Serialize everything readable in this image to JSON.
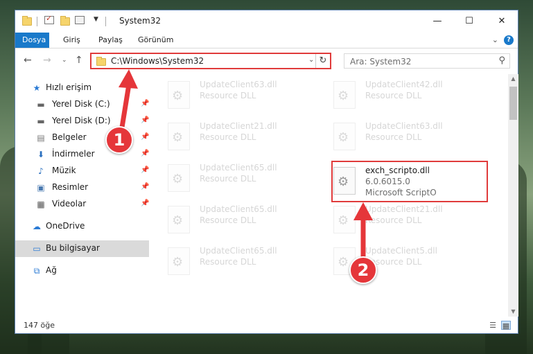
{
  "window": {
    "title": "System32",
    "controls": {
      "minimize": "—",
      "maximize": "☐",
      "close": "✕"
    }
  },
  "ribbon": {
    "tabs": [
      "Dosya",
      "Giriş",
      "Paylaş",
      "Görünüm"
    ],
    "help": "?"
  },
  "navigation": {
    "address": "C:\\Windows\\System32",
    "search_placeholder": "Ara: System32"
  },
  "sidebar": {
    "items": [
      {
        "label": "Hızlı erişim",
        "icon": "star-icon",
        "pinned": false
      },
      {
        "label": "Yerel Disk (C:)",
        "icon": "drive-icon",
        "pinned": true
      },
      {
        "label": "Yerel Disk (D:)",
        "icon": "drive-icon",
        "pinned": true
      },
      {
        "label": "Belgeler",
        "icon": "documents-icon",
        "pinned": true
      },
      {
        "label": "İndirmeler",
        "icon": "download-icon",
        "pinned": true
      },
      {
        "label": "Müzik",
        "icon": "music-icon",
        "pinned": true
      },
      {
        "label": "Resimler",
        "icon": "pictures-icon",
        "pinned": true
      },
      {
        "label": "Videolar",
        "icon": "videos-icon",
        "pinned": true
      },
      {
        "label": "OneDrive",
        "icon": "cloud-icon",
        "pinned": false
      },
      {
        "label": "Bu bilgisayar",
        "icon": "computer-icon",
        "pinned": false,
        "selected": true
      },
      {
        "label": "Ağ",
        "icon": "network-icon",
        "pinned": false
      }
    ]
  },
  "files": [
    {
      "name": "UpdateClient63.dll",
      "type": "Resource DLL",
      "faded": true
    },
    {
      "name": "UpdateClient42.dll",
      "type": "Resource DLL",
      "faded": true
    },
    {
      "name": "UpdateClient21.dll",
      "type": "Resource DLL",
      "faded": true
    },
    {
      "name": "UpdateClient63.dll",
      "type": "Resource DLL",
      "faded": true
    },
    {
      "name": "UpdateClient65.dll",
      "type": "Resource DLL",
      "faded": true
    },
    {
      "name": "exch_scripto.dll",
      "type": "6.0.6015.0",
      "company": "Microsoft ScriptO",
      "faded": false,
      "highlighted": true
    },
    {
      "name": "UpdateClient65.dll",
      "type": "Resource DLL",
      "faded": true
    },
    {
      "name": "UpdateClient21.dll",
      "type": "Resource DLL",
      "faded": true
    },
    {
      "name": "UpdateClient65.dll",
      "type": "Resource DLL",
      "faded": true
    },
    {
      "name": "UpdateClient5.dll",
      "type": "Resource DLL",
      "faded": true
    }
  ],
  "status": {
    "count": "147 öğe"
  },
  "annotations": {
    "marker1": "1",
    "marker2": "2",
    "arrow_color": "#e5363a"
  }
}
